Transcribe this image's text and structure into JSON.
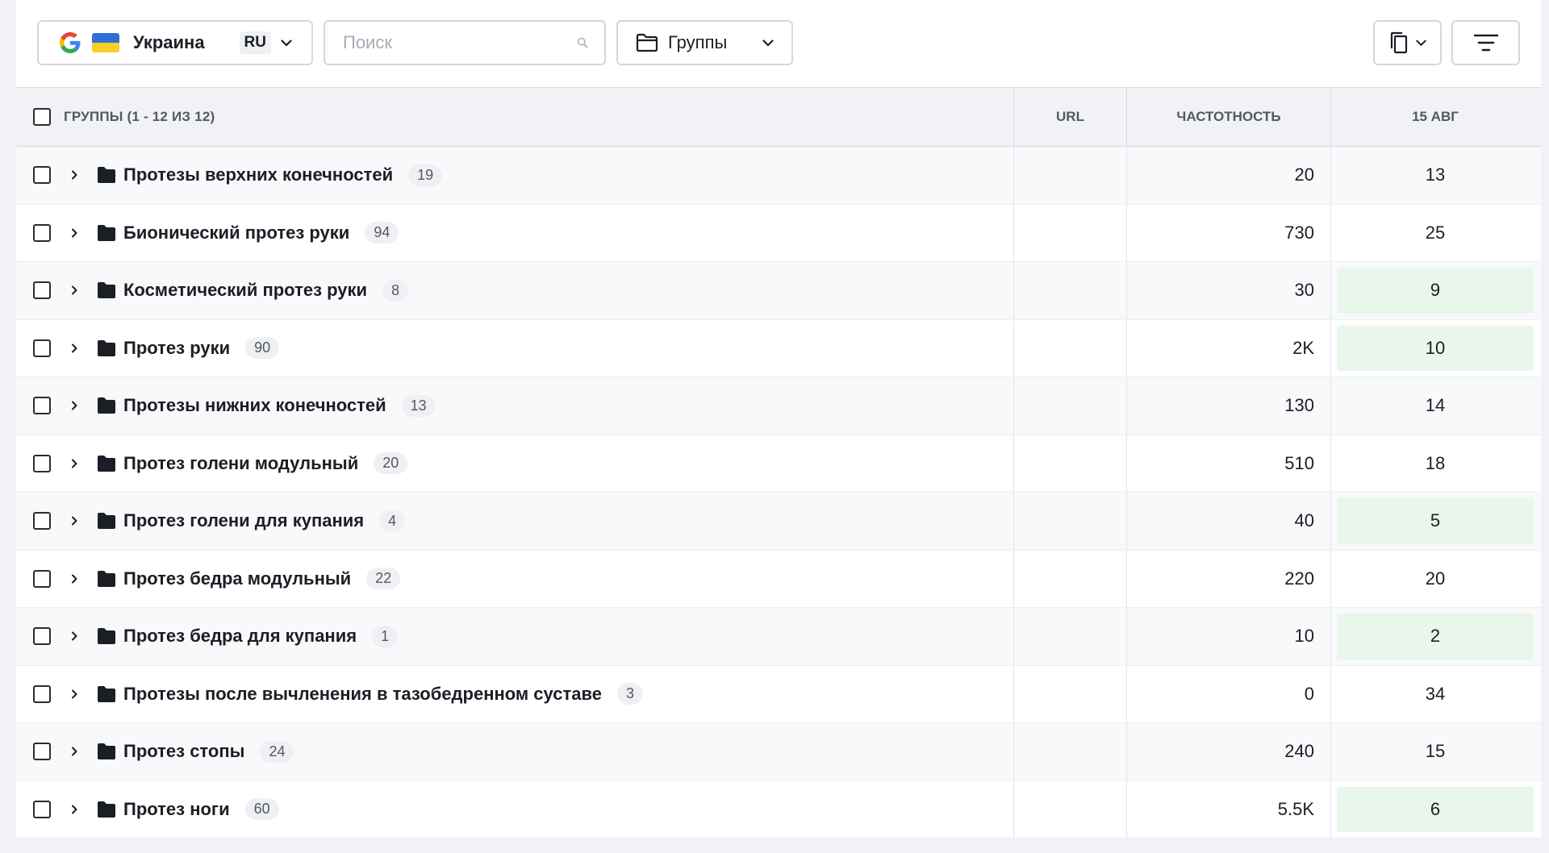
{
  "toolbar": {
    "search_engine_icon": "google-icon",
    "flag_icon": "ukraine-flag-icon",
    "country": "Украина",
    "language": "RU",
    "search_placeholder": "Поиск",
    "group_selector_label": "Группы"
  },
  "colors": {
    "highlight_green": "#e9f6eb",
    "flag_blue": "#2f6fd6",
    "flag_yellow": "#f7cf25"
  },
  "table": {
    "header": {
      "groups": "ГРУППЫ (1 - 12 ИЗ 12)",
      "url": "URL",
      "frequency": "ЧАСТОТНОСТЬ",
      "date": "15 АВГ"
    },
    "rows": [
      {
        "name": "Протезы верхних конечностей",
        "count": "19",
        "frequency": "20",
        "position": "13",
        "highlight": false
      },
      {
        "name": "Бионический протез руки",
        "count": "94",
        "frequency": "730",
        "position": "25",
        "highlight": false
      },
      {
        "name": "Косметический протез руки",
        "count": "8",
        "frequency": "30",
        "position": "9",
        "highlight": true
      },
      {
        "name": "Протез руки",
        "count": "90",
        "frequency": "2K",
        "position": "10",
        "highlight": true
      },
      {
        "name": "Протезы нижних конечностей",
        "count": "13",
        "frequency": "130",
        "position": "14",
        "highlight": false
      },
      {
        "name": "Протез голени модульный",
        "count": "20",
        "frequency": "510",
        "position": "18",
        "highlight": false
      },
      {
        "name": "Протез голени для купания",
        "count": "4",
        "frequency": "40",
        "position": "5",
        "highlight": true
      },
      {
        "name": "Протез бедра модульный",
        "count": "22",
        "frequency": "220",
        "position": "20",
        "highlight": false
      },
      {
        "name": "Протез бедра для купания",
        "count": "1",
        "frequency": "10",
        "position": "2",
        "highlight": true
      },
      {
        "name": "Протезы после вычленения в тазобедренном суставе",
        "count": "3",
        "frequency": "0",
        "position": "34",
        "highlight": false
      },
      {
        "name": "Протез стопы",
        "count": "24",
        "frequency": "240",
        "position": "15",
        "highlight": false
      },
      {
        "name": "Протез ноги",
        "count": "60",
        "frequency": "5.5K",
        "position": "6",
        "highlight": true
      }
    ]
  }
}
